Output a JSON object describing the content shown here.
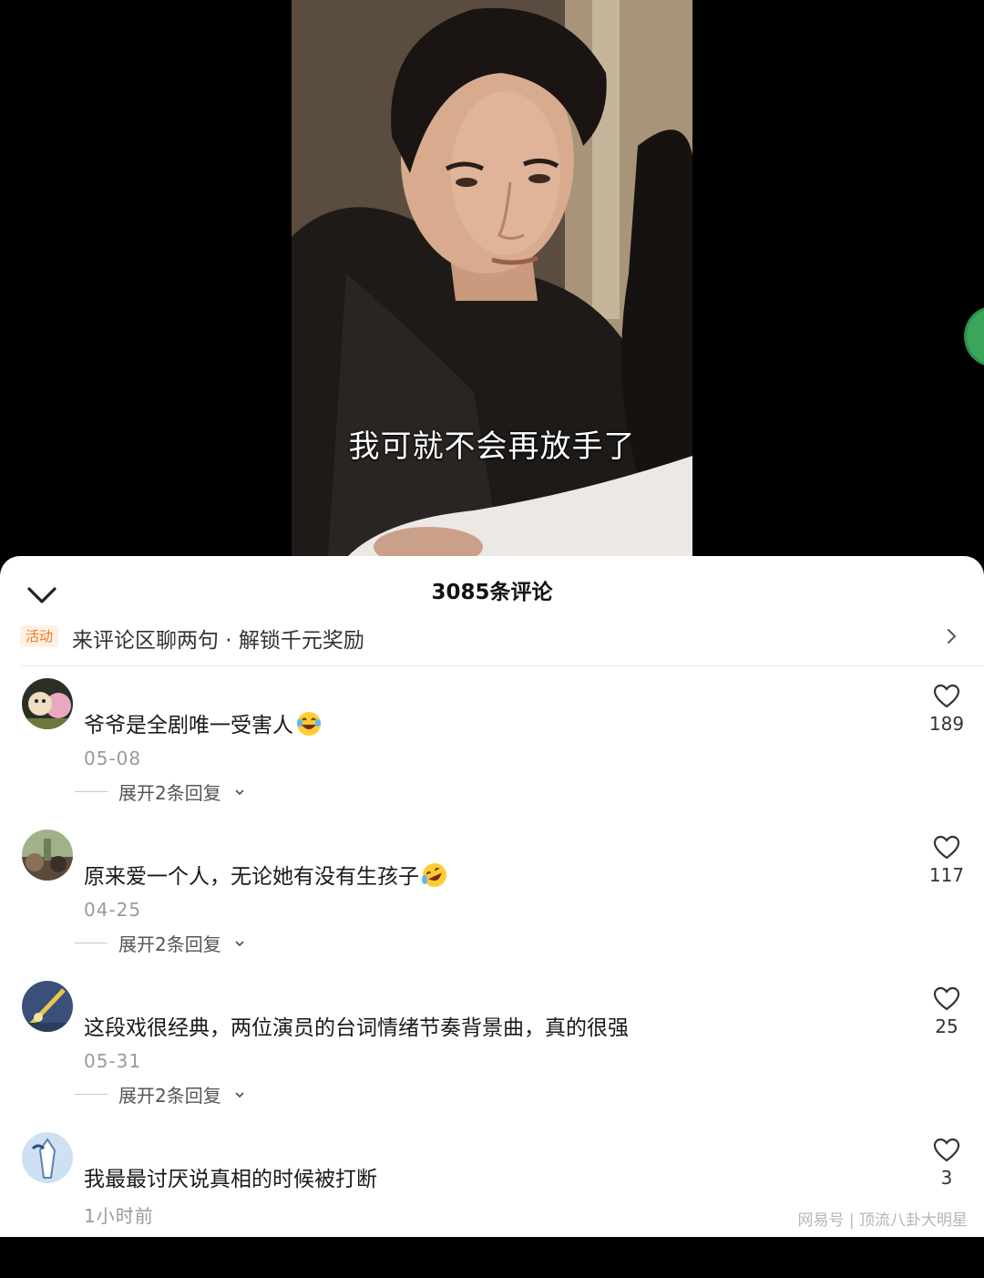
{
  "video": {
    "subtitle": "我可就不会再放手了"
  },
  "comments_panel": {
    "title": "3085条评论",
    "promo_tag": "活动",
    "promo_text": "来评论区聊两句 · 解锁千元奖励",
    "comments": [
      {
        "text": "爷爷是全剧唯一受害人",
        "emoji": "laughing-tears-emoji",
        "date": "05-08",
        "replies": "展开2条回复",
        "likes": "189"
      },
      {
        "text": "原来爱一个人，无论她有没有生孩子",
        "emoji": "rolling-laugh-emoji",
        "date": "04-25",
        "replies": "展开2条回复",
        "likes": "117"
      },
      {
        "text": "这段戏很经典，两位演员的台词情绪节奏背景曲，真的很强",
        "emoji": "",
        "date": "05-31",
        "replies": "展开2条回复",
        "likes": "25"
      },
      {
        "text": "我最最讨厌说真相的时候被打断",
        "emoji": "",
        "date": "1小时前",
        "replies": "",
        "likes": "3"
      }
    ]
  },
  "watermark": "网易号 | 顶流八卦大明星",
  "colors": {
    "accent": "#f07a1a",
    "sheet_bg": "#ffffff",
    "backdrop": "#000000"
  }
}
